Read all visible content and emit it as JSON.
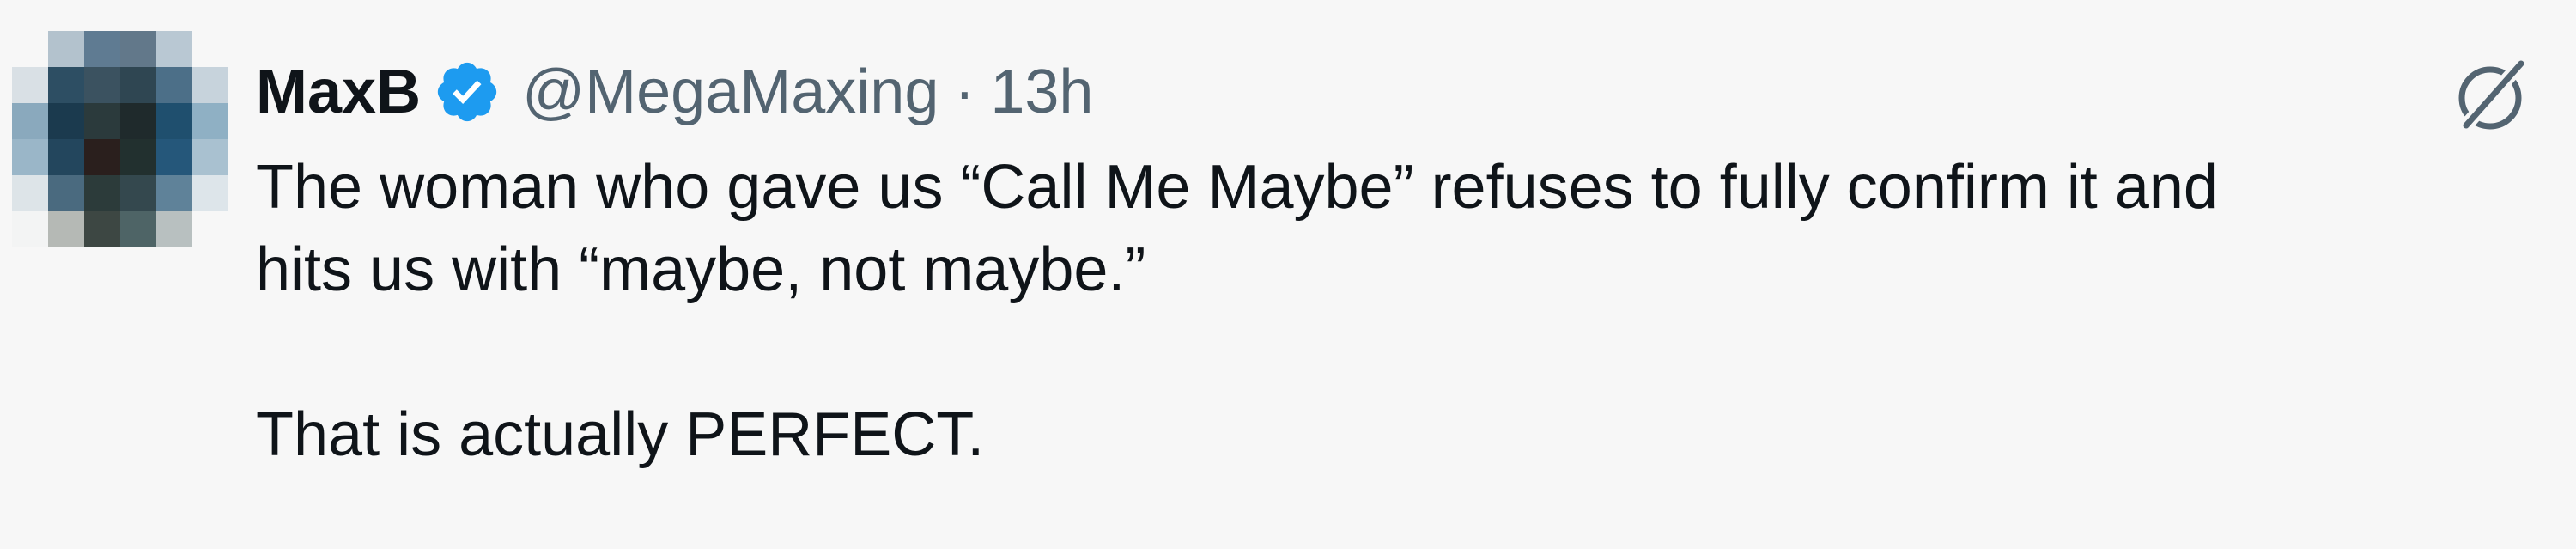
{
  "tweet": {
    "author": {
      "name": "MaxB",
      "handle": "@MegaMaxing",
      "verified": true,
      "avatar_icon": "pixelated-avatar"
    },
    "separator": "·",
    "time": "13h",
    "grok_icon": "grok-icon",
    "text": {
      "line1": "The woman who gave us “Call Me Maybe” refuses to fully confirm it and",
      "line2": "hits us with “maybe, not maybe.”",
      "line3": "That is actually PERFECT."
    }
  },
  "colors": {
    "background": "#f7f7f7",
    "text": "#0f1419",
    "secondary": "#536471",
    "verified": "#1d9bf0"
  }
}
